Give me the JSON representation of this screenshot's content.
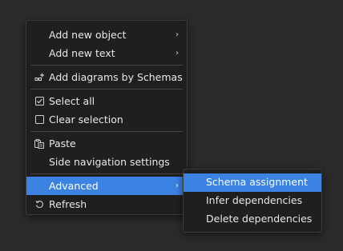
{
  "context_menu": {
    "groups": [
      {
        "items": [
          {
            "label": "Add new object",
            "submenu": true
          },
          {
            "label": "Add new text",
            "submenu": true
          }
        ]
      },
      {
        "items": [
          {
            "label": "Add diagrams by Schemas",
            "icon": "add-diagram-icon"
          }
        ]
      },
      {
        "items": [
          {
            "label": "Select all",
            "icon": "checked-checkbox-icon"
          },
          {
            "label": "Clear selection",
            "icon": "empty-checkbox-icon"
          }
        ]
      },
      {
        "items": [
          {
            "label": "Paste",
            "icon": "paste-icon"
          },
          {
            "label": "Side navigation settings"
          }
        ]
      },
      {
        "items": [
          {
            "label": "Advanced",
            "submenu": true,
            "highlighted": true
          },
          {
            "label": "Refresh",
            "icon": "refresh-icon"
          }
        ]
      }
    ]
  },
  "advanced_submenu": {
    "items": [
      {
        "label": "Schema assignment",
        "highlighted": true
      },
      {
        "label": "Infer dependencies"
      },
      {
        "label": "Delete dependencies"
      }
    ]
  },
  "colors": {
    "background": "#2b2b2b",
    "menu_background": "#1f1f1f",
    "highlight": "#3b82e3",
    "text": "#e8e8e8"
  }
}
